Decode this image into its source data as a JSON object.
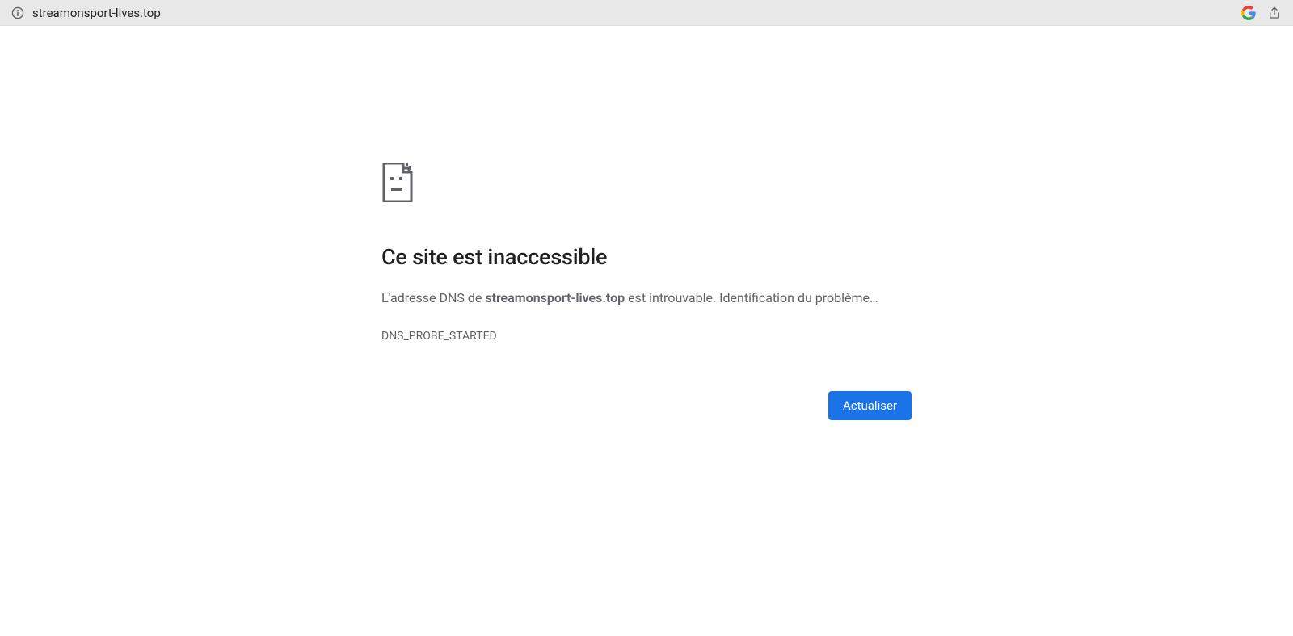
{
  "omnibox": {
    "url": "streamonsport-lives.top"
  },
  "error": {
    "heading": "Ce site est inaccessible",
    "desc_prefix": "L'adresse DNS de ",
    "desc_domain": "streamonsport-lives.top",
    "desc_suffix": " est introuvable. Identification du problème…",
    "code": "DNS_PROBE_STARTED",
    "reload_label": "Actualiser"
  }
}
